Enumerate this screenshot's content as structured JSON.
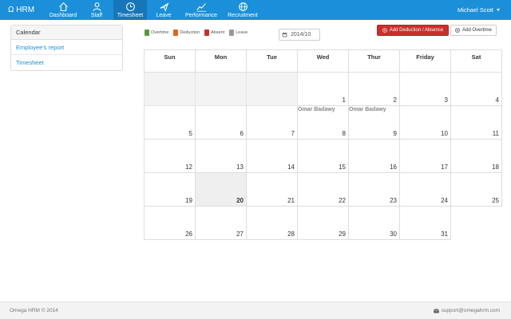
{
  "nav": {
    "brand": "Ω HRM",
    "items": [
      {
        "label": "Dashboard",
        "icon": "home-icon"
      },
      {
        "label": "Staff",
        "icon": "user-icon"
      },
      {
        "label": "Timesheet",
        "icon": "clock-icon",
        "active": true
      },
      {
        "label": "Leave",
        "icon": "plane-icon"
      },
      {
        "label": "Performance",
        "icon": "chart-line-icon"
      },
      {
        "label": "Recruitment",
        "icon": "globe-icon"
      }
    ],
    "user": "Michael Scott"
  },
  "sidebar": {
    "heading": "Calendar",
    "links": [
      {
        "label": "Employee's report"
      },
      {
        "label": "Timesheet"
      }
    ]
  },
  "legend": [
    {
      "label": "Overtime",
      "color": "#5b9a3a"
    },
    {
      "label": "Deduction",
      "color": "#e0661a"
    },
    {
      "label": "Absent",
      "color": "#c9302c"
    },
    {
      "label": "Leave",
      "color": "#999999"
    }
  ],
  "date_input": {
    "value": "2014/10"
  },
  "buttons": {
    "add_deduction": "Add Deduction / Absence",
    "add_overtime": "Add Overtime"
  },
  "calendar": {
    "weekdays": [
      "Sun",
      "Mon",
      "Tue",
      "Wed",
      "Thur",
      "Friday",
      "Sat"
    ],
    "weeks": [
      [
        {
          "d": ""
        },
        {
          "d": ""
        },
        {
          "d": ""
        },
        {
          "d": "1"
        },
        {
          "d": "2"
        },
        {
          "d": "3"
        },
        {
          "d": "4"
        }
      ],
      [
        {
          "d": "5"
        },
        {
          "d": "6"
        },
        {
          "d": "7"
        },
        {
          "d": "8",
          "event": "Omar Badawy"
        },
        {
          "d": "9",
          "event": "Omar Badawy"
        },
        {
          "d": "10"
        },
        {
          "d": "11"
        }
      ],
      [
        {
          "d": "12"
        },
        {
          "d": "13"
        },
        {
          "d": "14"
        },
        {
          "d": "15"
        },
        {
          "d": "16"
        },
        {
          "d": "17"
        },
        {
          "d": "18"
        }
      ],
      [
        {
          "d": "19"
        },
        {
          "d": "20",
          "today": true
        },
        {
          "d": "21"
        },
        {
          "d": "22"
        },
        {
          "d": "23"
        },
        {
          "d": "24"
        },
        {
          "d": "25"
        }
      ],
      [
        {
          "d": "26"
        },
        {
          "d": "27"
        },
        {
          "d": "28"
        },
        {
          "d": "29"
        },
        {
          "d": "30"
        },
        {
          "d": "31"
        },
        {
          "d": ""
        }
      ]
    ]
  },
  "footer": {
    "copyright": "Omega HRM © 2014",
    "email": "support@omegahrm.com"
  }
}
